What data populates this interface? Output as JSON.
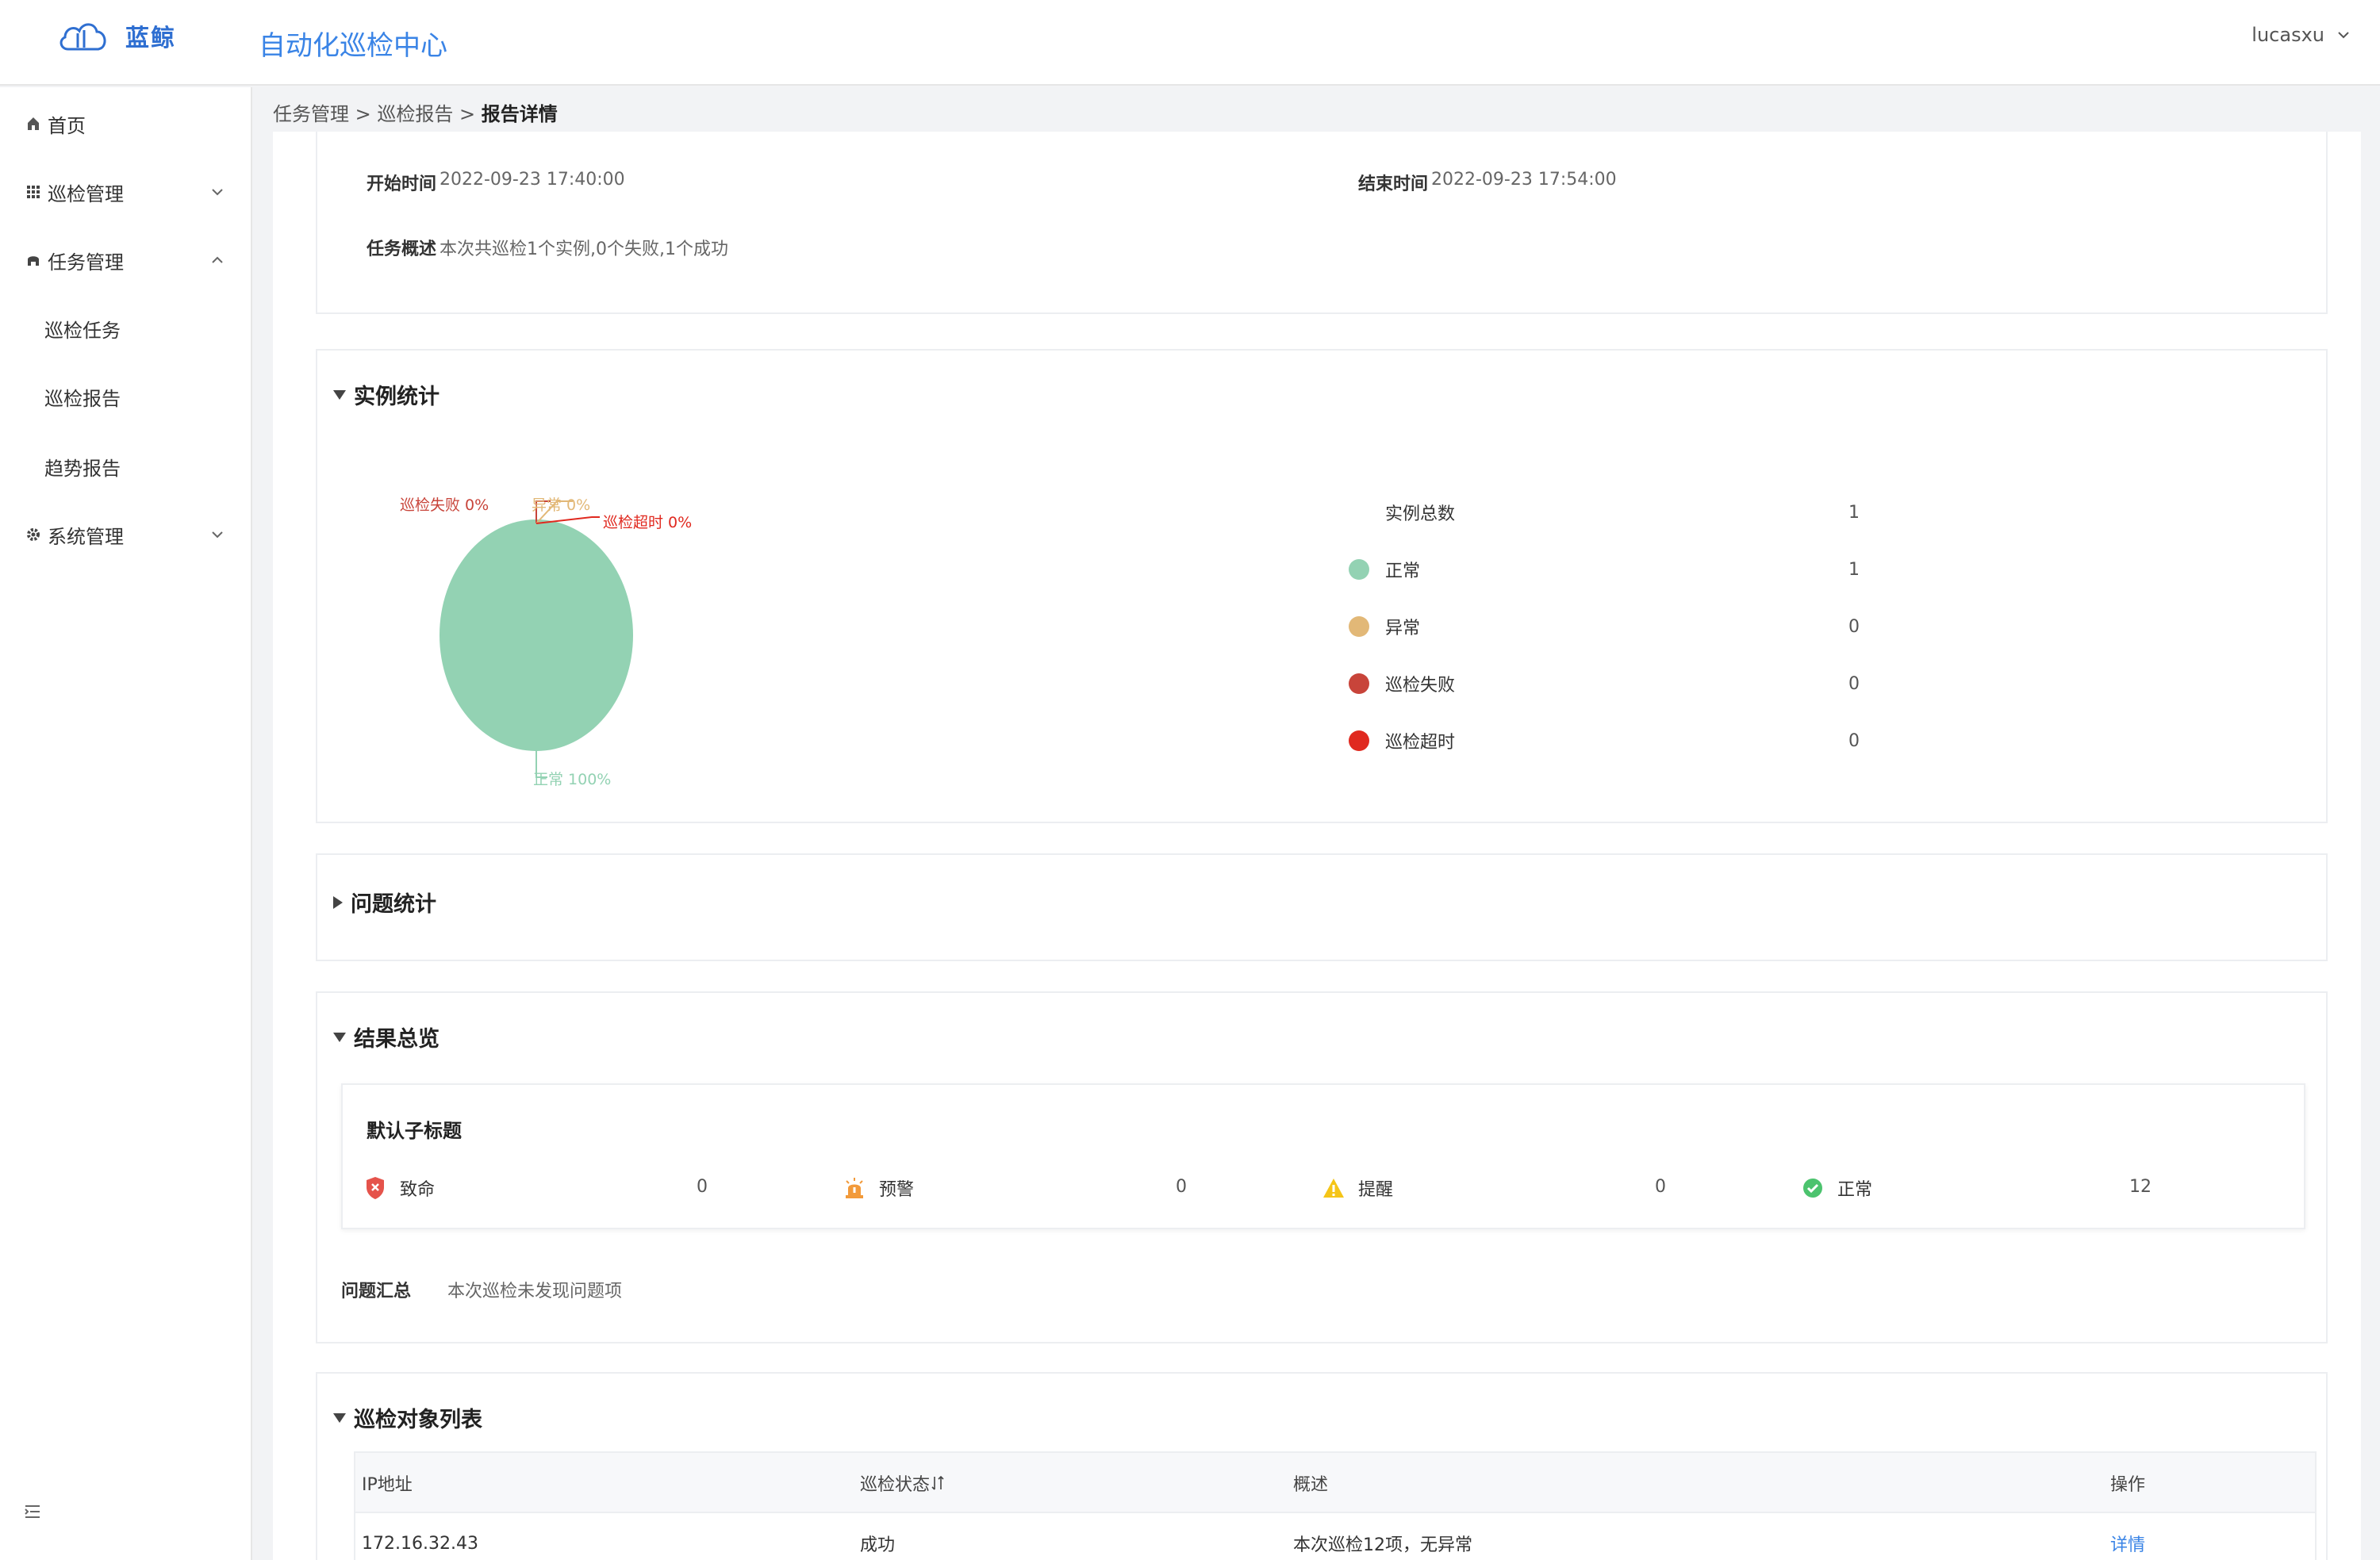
{
  "header": {
    "logo_text": "蓝鲸",
    "app_title": "自动化巡检中心",
    "user": "lucasxu"
  },
  "sidebar": {
    "items": [
      {
        "label": "首页",
        "icon": "home-icon"
      },
      {
        "label": "巡检管理",
        "icon": "grid-icon"
      },
      {
        "label": "任务管理",
        "icon": "task-icon"
      },
      {
        "label": "系统管理",
        "icon": "gear-icon"
      }
    ],
    "sub_items": [
      "巡检任务",
      "巡检报告",
      "趋势报告"
    ]
  },
  "breadcrumb": {
    "level1": "任务管理",
    "level2": "巡检报告",
    "current": "报告详情",
    "separator": ">"
  },
  "task_info": {
    "start_label": "开始时间",
    "start_value": "2022-09-23 17:40:00",
    "end_label": "结束时间",
    "end_value": "2022-09-23 17:54:00",
    "summary_label": "任务概述",
    "summary_value": "本次共巡检1个实例,0个失败,1个成功"
  },
  "instance_stats": {
    "title": "实例统计",
    "total_label": "实例总数",
    "total_value": "1",
    "pie_labels": {
      "fail": "巡检失败 0%",
      "abnormal": "异常 0%",
      "timeout": "巡检超时 0%",
      "normal": "正常 100%"
    },
    "legend": [
      {
        "label": "正常",
        "value": "1",
        "color": "#93d2b3"
      },
      {
        "label": "异常",
        "value": "0",
        "color": "#e2b877"
      },
      {
        "label": "巡检失败",
        "value": "0",
        "color": "#c8443a"
      },
      {
        "label": "巡检超时",
        "value": "0",
        "color": "#e0291f"
      }
    ]
  },
  "chart_data": {
    "type": "pie",
    "categories": [
      "正常",
      "异常",
      "巡检失败",
      "巡检超时"
    ],
    "values": [
      100,
      0,
      0,
      0
    ],
    "colors": [
      "#93d2b3",
      "#e2b877",
      "#c8443a",
      "#e0291f"
    ]
  },
  "issue_stats": {
    "title": "问题统计"
  },
  "result_overview": {
    "title": "结果总览",
    "subtitle": "默认子标题",
    "items": [
      {
        "label": "致命",
        "value": "0",
        "icon": "fatal-shield-icon",
        "color": "#e5534b"
      },
      {
        "label": "预警",
        "value": "0",
        "icon": "alarm-icon",
        "color": "#f29a3a"
      },
      {
        "label": "提醒",
        "value": "0",
        "icon": "warning-triangle-icon",
        "color": "#f5c518"
      },
      {
        "label": "正常",
        "value": "12",
        "icon": "check-circle-icon",
        "color": "#4cc36e"
      }
    ],
    "issue_summary_label": "问题汇总",
    "issue_summary_value": "本次巡检未发现问题项"
  },
  "object_list": {
    "title": "巡检对象列表",
    "columns": [
      "IP地址",
      "巡检状态",
      "概述",
      "操作"
    ],
    "rows": [
      {
        "ip": "172.16.32.43",
        "status": "成功",
        "summary": "本次巡检12项，无异常",
        "action": "详情"
      }
    ]
  }
}
